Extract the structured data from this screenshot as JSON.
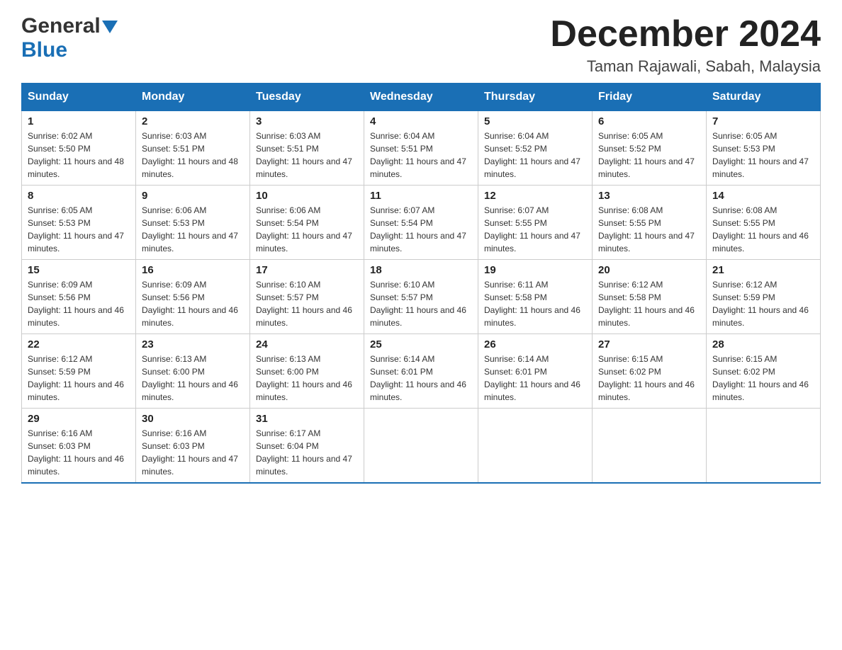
{
  "header": {
    "logo_general": "General",
    "logo_blue": "Blue",
    "month_title": "December 2024",
    "location": "Taman Rajawali, Sabah, Malaysia"
  },
  "calendar": {
    "days_of_week": [
      "Sunday",
      "Monday",
      "Tuesday",
      "Wednesday",
      "Thursday",
      "Friday",
      "Saturday"
    ],
    "weeks": [
      [
        {
          "day": "1",
          "sunrise": "6:02 AM",
          "sunset": "5:50 PM",
          "daylight": "11 hours and 48 minutes."
        },
        {
          "day": "2",
          "sunrise": "6:03 AM",
          "sunset": "5:51 PM",
          "daylight": "11 hours and 48 minutes."
        },
        {
          "day": "3",
          "sunrise": "6:03 AM",
          "sunset": "5:51 PM",
          "daylight": "11 hours and 47 minutes."
        },
        {
          "day": "4",
          "sunrise": "6:04 AM",
          "sunset": "5:51 PM",
          "daylight": "11 hours and 47 minutes."
        },
        {
          "day": "5",
          "sunrise": "6:04 AM",
          "sunset": "5:52 PM",
          "daylight": "11 hours and 47 minutes."
        },
        {
          "day": "6",
          "sunrise": "6:05 AM",
          "sunset": "5:52 PM",
          "daylight": "11 hours and 47 minutes."
        },
        {
          "day": "7",
          "sunrise": "6:05 AM",
          "sunset": "5:53 PM",
          "daylight": "11 hours and 47 minutes."
        }
      ],
      [
        {
          "day": "8",
          "sunrise": "6:05 AM",
          "sunset": "5:53 PM",
          "daylight": "11 hours and 47 minutes."
        },
        {
          "day": "9",
          "sunrise": "6:06 AM",
          "sunset": "5:53 PM",
          "daylight": "11 hours and 47 minutes."
        },
        {
          "day": "10",
          "sunrise": "6:06 AM",
          "sunset": "5:54 PM",
          "daylight": "11 hours and 47 minutes."
        },
        {
          "day": "11",
          "sunrise": "6:07 AM",
          "sunset": "5:54 PM",
          "daylight": "11 hours and 47 minutes."
        },
        {
          "day": "12",
          "sunrise": "6:07 AM",
          "sunset": "5:55 PM",
          "daylight": "11 hours and 47 minutes."
        },
        {
          "day": "13",
          "sunrise": "6:08 AM",
          "sunset": "5:55 PM",
          "daylight": "11 hours and 47 minutes."
        },
        {
          "day": "14",
          "sunrise": "6:08 AM",
          "sunset": "5:55 PM",
          "daylight": "11 hours and 46 minutes."
        }
      ],
      [
        {
          "day": "15",
          "sunrise": "6:09 AM",
          "sunset": "5:56 PM",
          "daylight": "11 hours and 46 minutes."
        },
        {
          "day": "16",
          "sunrise": "6:09 AM",
          "sunset": "5:56 PM",
          "daylight": "11 hours and 46 minutes."
        },
        {
          "day": "17",
          "sunrise": "6:10 AM",
          "sunset": "5:57 PM",
          "daylight": "11 hours and 46 minutes."
        },
        {
          "day": "18",
          "sunrise": "6:10 AM",
          "sunset": "5:57 PM",
          "daylight": "11 hours and 46 minutes."
        },
        {
          "day": "19",
          "sunrise": "6:11 AM",
          "sunset": "5:58 PM",
          "daylight": "11 hours and 46 minutes."
        },
        {
          "day": "20",
          "sunrise": "6:12 AM",
          "sunset": "5:58 PM",
          "daylight": "11 hours and 46 minutes."
        },
        {
          "day": "21",
          "sunrise": "6:12 AM",
          "sunset": "5:59 PM",
          "daylight": "11 hours and 46 minutes."
        }
      ],
      [
        {
          "day": "22",
          "sunrise": "6:12 AM",
          "sunset": "5:59 PM",
          "daylight": "11 hours and 46 minutes."
        },
        {
          "day": "23",
          "sunrise": "6:13 AM",
          "sunset": "6:00 PM",
          "daylight": "11 hours and 46 minutes."
        },
        {
          "day": "24",
          "sunrise": "6:13 AM",
          "sunset": "6:00 PM",
          "daylight": "11 hours and 46 minutes."
        },
        {
          "day": "25",
          "sunrise": "6:14 AM",
          "sunset": "6:01 PM",
          "daylight": "11 hours and 46 minutes."
        },
        {
          "day": "26",
          "sunrise": "6:14 AM",
          "sunset": "6:01 PM",
          "daylight": "11 hours and 46 minutes."
        },
        {
          "day": "27",
          "sunrise": "6:15 AM",
          "sunset": "6:02 PM",
          "daylight": "11 hours and 46 minutes."
        },
        {
          "day": "28",
          "sunrise": "6:15 AM",
          "sunset": "6:02 PM",
          "daylight": "11 hours and 46 minutes."
        }
      ],
      [
        {
          "day": "29",
          "sunrise": "6:16 AM",
          "sunset": "6:03 PM",
          "daylight": "11 hours and 46 minutes."
        },
        {
          "day": "30",
          "sunrise": "6:16 AM",
          "sunset": "6:03 PM",
          "daylight": "11 hours and 47 minutes."
        },
        {
          "day": "31",
          "sunrise": "6:17 AM",
          "sunset": "6:04 PM",
          "daylight": "11 hours and 47 minutes."
        },
        null,
        null,
        null,
        null
      ]
    ],
    "labels": {
      "sunrise": "Sunrise:",
      "sunset": "Sunset:",
      "daylight": "Daylight:"
    }
  }
}
